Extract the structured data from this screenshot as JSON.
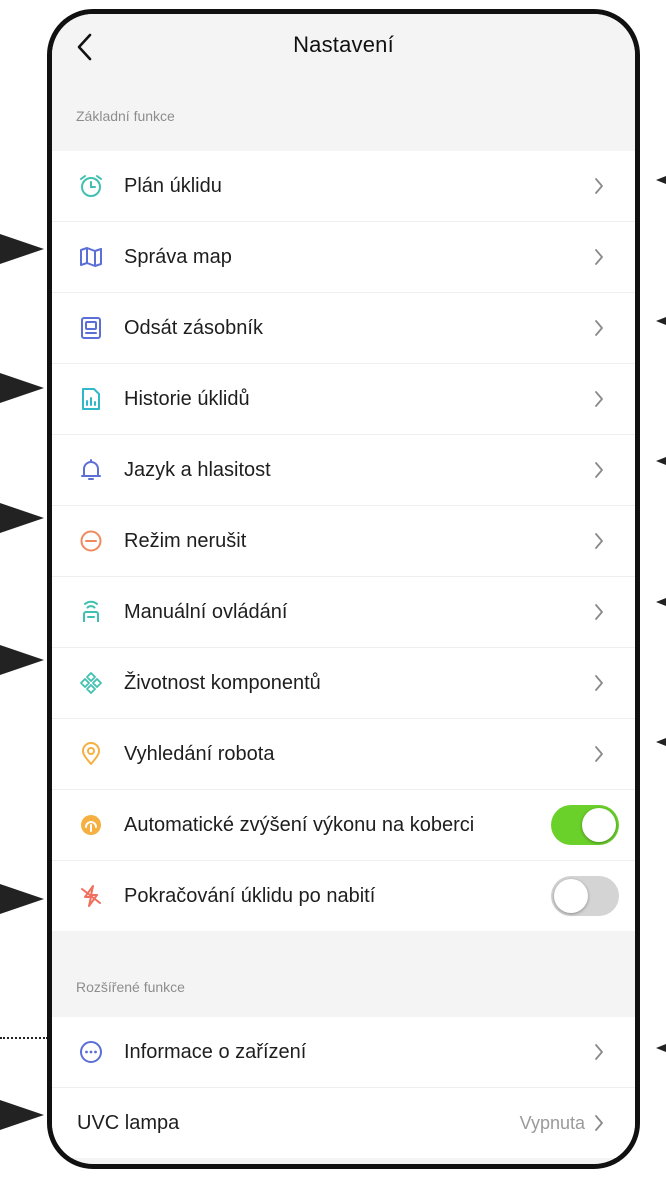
{
  "header": {
    "title": "Nastavení",
    "back_icon": "chevron-left-icon"
  },
  "sections": [
    {
      "title": "Základní funkce",
      "items": [
        {
          "label": "Plán úklidu",
          "icon": "alarm-clock-icon",
          "icon_color": "#3fc0b0",
          "control": "chevron"
        },
        {
          "label": "Správa map",
          "icon": "map-icon",
          "icon_color": "#5b6fd6",
          "control": "chevron"
        },
        {
          "label": "Odsát zásobník",
          "icon": "dustbin-station-icon",
          "icon_color": "#5b6fd6",
          "control": "chevron"
        },
        {
          "label": "Historie úklidů",
          "icon": "history-chart-icon",
          "icon_color": "#2fb8c8",
          "control": "chevron"
        },
        {
          "label": "Jazyk a hlasitost",
          "icon": "bell-icon",
          "icon_color": "#5b6fd6",
          "control": "chevron"
        },
        {
          "label": "Režim nerušit",
          "icon": "do-not-disturb-icon",
          "icon_color": "#f08a5d",
          "control": "chevron"
        },
        {
          "label": "Manuální ovládání",
          "icon": "remote-control-icon",
          "icon_color": "#3fc0b0",
          "control": "chevron"
        },
        {
          "label": "Životnost komponentů",
          "icon": "components-icon",
          "icon_color": "#3fc0b0",
          "control": "chevron"
        },
        {
          "label": "Vyhledání robota",
          "icon": "location-pin-icon",
          "icon_color": "#f5b041",
          "control": "chevron"
        },
        {
          "label": "Automatické zvýšení výkonu na koberci",
          "icon": "carpet-boost-icon",
          "icon_color": "#f5b041",
          "control": "toggle",
          "toggle_on": true
        },
        {
          "label": "Pokračování úklidu po nabití",
          "icon": "charge-resume-icon",
          "icon_color": "#f0705d",
          "control": "toggle",
          "toggle_on": false
        }
      ]
    },
    {
      "title": "Rozšířené funkce",
      "items": [
        {
          "label": "Informace o  zařízení",
          "icon": "info-dots-icon",
          "icon_color": "#5b6fd6",
          "control": "chevron"
        },
        {
          "label": "UVC lampa",
          "icon": "",
          "control": "value-chevron",
          "value": "Vypnuta"
        }
      ]
    }
  ],
  "colors": {
    "toggle_on": "#6ad02a",
    "toggle_off": "#d4d4d4",
    "background": "#f4f4f4"
  }
}
